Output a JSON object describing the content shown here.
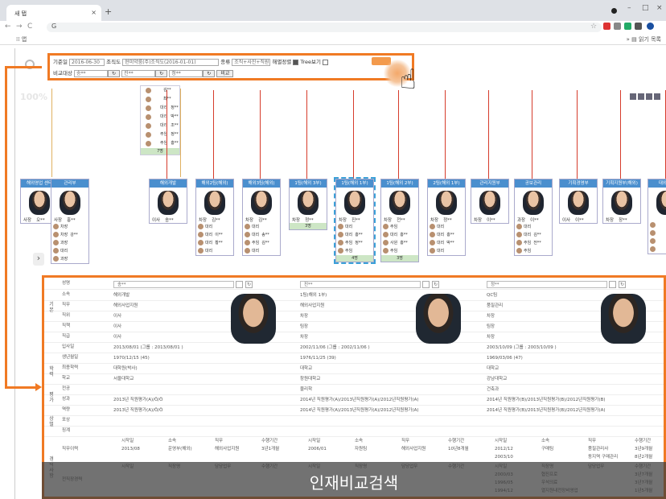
{
  "browser": {
    "tab_title": "새 탭",
    "tab_close": "×",
    "new_tab": "+",
    "omni_prefix": "G",
    "apps_label": "앱",
    "reading_list": "읽기 목록"
  },
  "filter": {
    "date_label": "기준일",
    "date_value": "2016-06-30",
    "org_label": "조직도",
    "org_value": "현미약룸(주)조직도(2016-01-01)",
    "type_label": "종류",
    "type_value": "조직+사진+직원",
    "scale_label": "해별정렬",
    "tree_label": "Tree보기",
    "compare_label": "비교대상",
    "person1": "송**",
    "person2": "진**",
    "person3": "정**",
    "compare_btn": "비교"
  },
  "pct": "100%",
  "top_column": {
    "rows": [
      {
        "role": "",
        "name": "김**"
      },
      {
        "role": "",
        "name": "최**"
      },
      {
        "role": "대리",
        "name": "정**"
      },
      {
        "role": "대리",
        "name": "박**"
      },
      {
        "role": "대리",
        "name": "조**"
      },
      {
        "role": "주임",
        "name": "정**"
      },
      {
        "role": "주임",
        "name": "홍**"
      }
    ],
    "count": "7명"
  },
  "org_nodes": [
    {
      "title": "해외영업 센터",
      "role": "사장",
      "name": "오**",
      "subs": []
    },
    {
      "title": "관리부",
      "role": "사장",
      "name": "홍**",
      "subs": [
        {
          "r": "차장",
          "n": ""
        },
        {
          "r": "차장",
          "n": "강**"
        },
        {
          "r": "과장",
          "n": ""
        },
        {
          "r": "대리",
          "n": ""
        },
        {
          "r": "과장",
          "n": ""
        }
      ]
    },
    {
      "title": "해외개발",
      "role": "이사",
      "name": "송**",
      "subs": []
    },
    {
      "title": "해외2팀(해외)",
      "role": "차장",
      "name": "김**",
      "subs": [
        {
          "r": "대리",
          "n": ""
        },
        {
          "r": "대리",
          "n": "이**"
        },
        {
          "r": "대리",
          "n": "황**"
        },
        {
          "r": "대리",
          "n": ""
        }
      ]
    },
    {
      "title": "해외3팀(해외)",
      "role": "차장",
      "name": "김**",
      "subs": [
        {
          "r": "대리",
          "n": ""
        },
        {
          "r": "대리",
          "n": "송**"
        },
        {
          "r": "주임",
          "n": "김**"
        },
        {
          "r": "대리",
          "n": ""
        }
      ]
    },
    {
      "title": "1팀(해외 3부)",
      "role": "차장",
      "name": "정**",
      "subs": [],
      "count": "3명"
    },
    {
      "title": "1팀(해외 1부)",
      "role": "차장",
      "name": "진**",
      "subs": [
        {
          "r": "대리",
          "n": ""
        },
        {
          "r": "대리",
          "n": "홍**"
        },
        {
          "r": "주임",
          "n": "정**"
        },
        {
          "r": "주임",
          "n": ""
        }
      ],
      "count": "4명"
    },
    {
      "title": "1팀(해외 2부)",
      "role": "차장",
      "name": "전**",
      "subs": [
        {
          "r": "주임",
          "n": ""
        },
        {
          "r": "대리",
          "n": "홍**"
        },
        {
          "r": "사원",
          "n": "홍**"
        },
        {
          "r": "주임",
          "n": ""
        }
      ],
      "count": "3명"
    },
    {
      "title": "2팀(해외 1부)",
      "role": "차장",
      "name": "정**",
      "subs": [
        {
          "r": "대리",
          "n": ""
        },
        {
          "r": "대리",
          "n": "홍**"
        },
        {
          "r": "대리",
          "n": "박**"
        },
        {
          "r": "대리",
          "n": ""
        }
      ]
    },
    {
      "title": "관리지원부",
      "role": "차장",
      "name": "이**",
      "subs": []
    },
    {
      "title": "공보관리",
      "role": "과장",
      "name": "이**",
      "subs": [
        {
          "r": "대리",
          "n": ""
        },
        {
          "r": "대리",
          "n": "김**"
        },
        {
          "r": "주임",
          "n": "전**"
        },
        {
          "r": "주임",
          "n": ""
        }
      ]
    },
    {
      "title": "기획경영부",
      "role": "이사",
      "name": "이**",
      "subs": []
    },
    {
      "title": "기획지원부(해외)",
      "role": "차장",
      "name": "장**",
      "subs": []
    },
    {
      "title": "대외협력",
      "role": "",
      "name": "",
      "subs": [
        {
          "r": "",
          "n": ""
        },
        {
          "r": "",
          "n": ""
        },
        {
          "r": "",
          "n": ""
        },
        {
          "r": "",
          "n": ""
        }
      ]
    }
  ],
  "compare": {
    "groups": [
      "기본",
      "학력",
      "평가",
      "상벌",
      "경력사항"
    ],
    "persons": [
      {
        "name": "송**",
        "dept": "해외개발",
        "duty": "해외사업지원",
        "position": "이사",
        "title": "이사",
        "level": "이사",
        "hire": "2013/08/01 (그룹 : 2013/08/01 )",
        "birth": "1970/12/15 (45)",
        "degree": "대학원(박사)",
        "school": "서울대학교",
        "major": "",
        "result": "2013년 직원평가(A)/Ö/Ö",
        "skill": "2013년 직원평가(A)/Ö/Ö"
      },
      {
        "name": "진**",
        "dept": "1팀(해외 1부)",
        "duty": "해외사업지원",
        "position": "차장",
        "title": "팀장",
        "level": "차장",
        "hire": "2002/11/06 (그룹 : 2002/11/06 )",
        "birth": "1976/11/25 (39)",
        "degree": "대학교",
        "school": "창원대학교",
        "major": "물리학",
        "result": "2014년 직원평가(A)/2013년직원평가(A)/2012년직원평가(A)",
        "skill": "2014년 직원평가(A)/2013년직원평가(A)/2012년직원평가(A)"
      },
      {
        "name": "정**",
        "dept": "QC팀",
        "duty": "품질관리",
        "position": "차장",
        "title": "팀장",
        "level": "차장",
        "hire": "2003/10/09 (그룹 : 2003/10/09 )",
        "birth": "1969/03/06 (47)",
        "degree": "대학교",
        "school": "강남대학교",
        "major": "건축과",
        "result": "2014년 직원평가(B)/2013년직원평가(B)/2012년직원평가(B)",
        "skill": "2014년 직원평가(B)/2013년직원평가(B)/2012년직원평가(A)"
      }
    ],
    "labels": {
      "name": "성명",
      "dept": "소속",
      "duty": "직무",
      "position": "직위",
      "title": "직책",
      "level": "직급",
      "hire": "입사일",
      "birth": "생년월일",
      "degree": "최종학력",
      "school": "학교",
      "major": "전공",
      "result": "성과",
      "skill": "역량",
      "reward": "포상",
      "punish": "징계",
      "career": "직무이력",
      "prev": "전직장경력"
    },
    "career_headers": [
      "시작일",
      "소속",
      "직무",
      "수행기간"
    ],
    "prev_headers": [
      "시작일",
      "직장명",
      "담당업무",
      "수행기간"
    ],
    "career": [
      [
        [
          "2013/08",
          "운영부(해외)",
          "해외사업지원",
          "3년1개월"
        ]
      ],
      [
        [
          "2006/01",
          "자원팀",
          "해외사업지원",
          "10년8개월"
        ]
      ],
      [
        [
          "2012/12",
          "구매팀",
          "품질관리사",
          "3년9개월"
        ],
        [
          "2003/10",
          "",
          "동지역 구매관리",
          "8년2개월"
        ]
      ]
    ],
    "prev_p3": [
      [
        "2000/03",
        "협진프로",
        "",
        "3년7개월"
      ],
      [
        "1996/05",
        "우석의료",
        "",
        "3년7개월"
      ],
      [
        "1994/12",
        "열지원내전장비영업",
        "",
        "1년5개월"
      ]
    ]
  },
  "caption": "인재비교검색"
}
